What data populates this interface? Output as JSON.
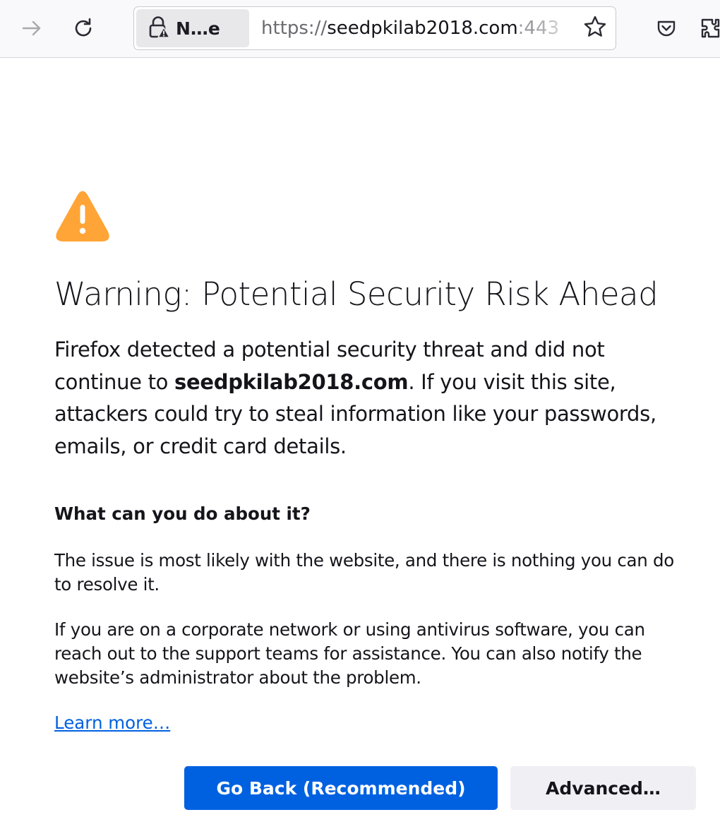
{
  "toolbar": {
    "identity_label": "N…e",
    "url_scheme": "https://",
    "url_host": "seedpkilab2018.com",
    "url_port": ":443"
  },
  "error_page": {
    "title": "Warning: Potential Security Risk Ahead",
    "intro_before": "Firefox detected a potential security threat and did not continue to ",
    "intro_host": "seedpkilab2018.com",
    "intro_after": ". If you visit this site, attackers could try to steal information like your passwords, emails, or credit card details.",
    "what_heading": "What can you do about it?",
    "para1": "The issue is most likely with the website, and there is nothing you can do to resolve it.",
    "para2": "If you are on a corporate network or using antivirus software, you can reach out to the support teams for assistance. You can also notify the website’s administrator about the problem.",
    "learn_more": "Learn more…",
    "go_back_label": "Go Back (Recommended)",
    "advanced_label": "Advanced…"
  },
  "icons": {
    "forward": "forward-arrow-icon",
    "reload": "reload-icon",
    "identity": "insecure-lock-icon",
    "bookmark": "star-icon",
    "pocket": "pocket-icon",
    "extensions": "extensions-icon",
    "warning": "warning-triangle-icon"
  },
  "colors": {
    "accent": "#0061e0",
    "warning": "#ffa436",
    "text": "#15141a"
  }
}
